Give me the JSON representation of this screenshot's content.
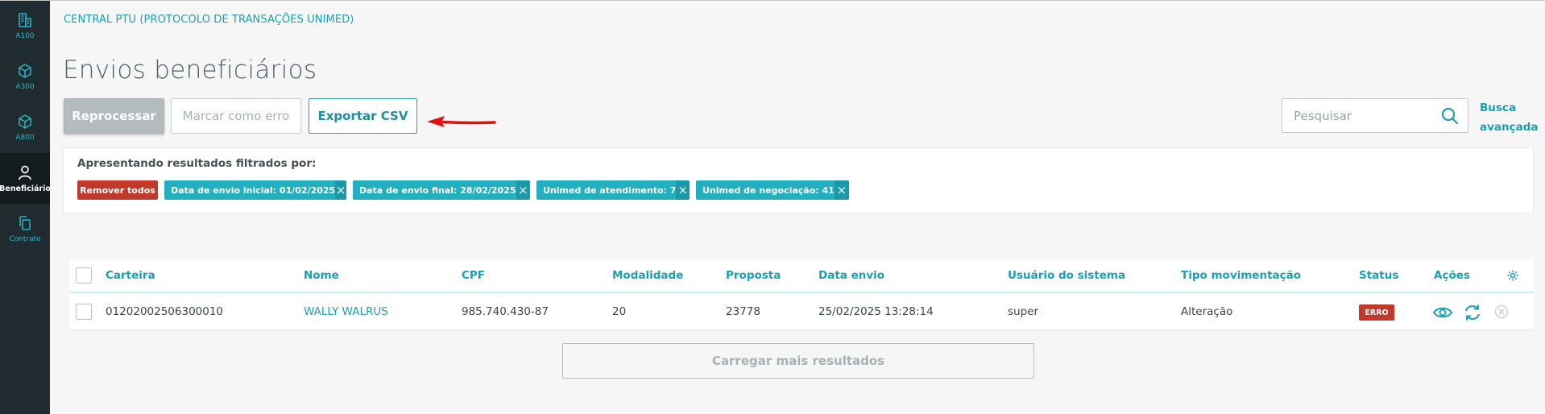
{
  "sidebar": {
    "items": [
      {
        "label": "A100",
        "icon": "building-icon"
      },
      {
        "label": "A300",
        "icon": "cube-icon"
      },
      {
        "label": "A800",
        "icon": "cube-icon"
      },
      {
        "label": "Beneficiário",
        "icon": "user-icon",
        "active": true
      },
      {
        "label": "Contrato",
        "icon": "copy-icon"
      }
    ]
  },
  "header": {
    "app_title": "CENTRAL PTU (PROTOCOLO DE TRANSAÇÕES UNIMED)",
    "page_title": "Envios beneficiários"
  },
  "toolbar": {
    "reprocess_label": "Reprocessar",
    "mark_error_label": "Marcar como erro",
    "export_label": "Exportar CSV"
  },
  "search": {
    "placeholder": "Pesquisar",
    "advanced_line1": "Busca",
    "advanced_line2": "avançada"
  },
  "filters": {
    "title": "Apresentando resultados filtrados por:",
    "remove_all": "Remover todos",
    "chips": [
      "Data de envio inicial: 01/02/2025",
      "Data de envio final: 28/02/2025",
      "Unimed de atendimento: 7",
      "Unimed de negociação: 41"
    ]
  },
  "table": {
    "columns": [
      "Carteira",
      "Nome",
      "CPF",
      "Modalidade",
      "Proposta",
      "Data envio",
      "Usuário do sistema",
      "Tipo movimentação",
      "Status",
      "Ações"
    ],
    "rows": [
      {
        "carteira": "01202002506300010",
        "nome": "WALLY WALRUS",
        "cpf": "985.740.430-87",
        "modalidade": "20",
        "proposta": "23778",
        "data_envio": "25/02/2025 13:28:14",
        "usuario": "super",
        "tipo": "Alteração",
        "status": "ERRO"
      }
    ]
  },
  "load_more_label": "Carregar mais resultados",
  "colors": {
    "accent": "#1e9fb1",
    "sidebar_bg": "#1f2b2e",
    "error": "#c0392b",
    "chip": "#22b0c0",
    "arrow": "#e01010"
  }
}
